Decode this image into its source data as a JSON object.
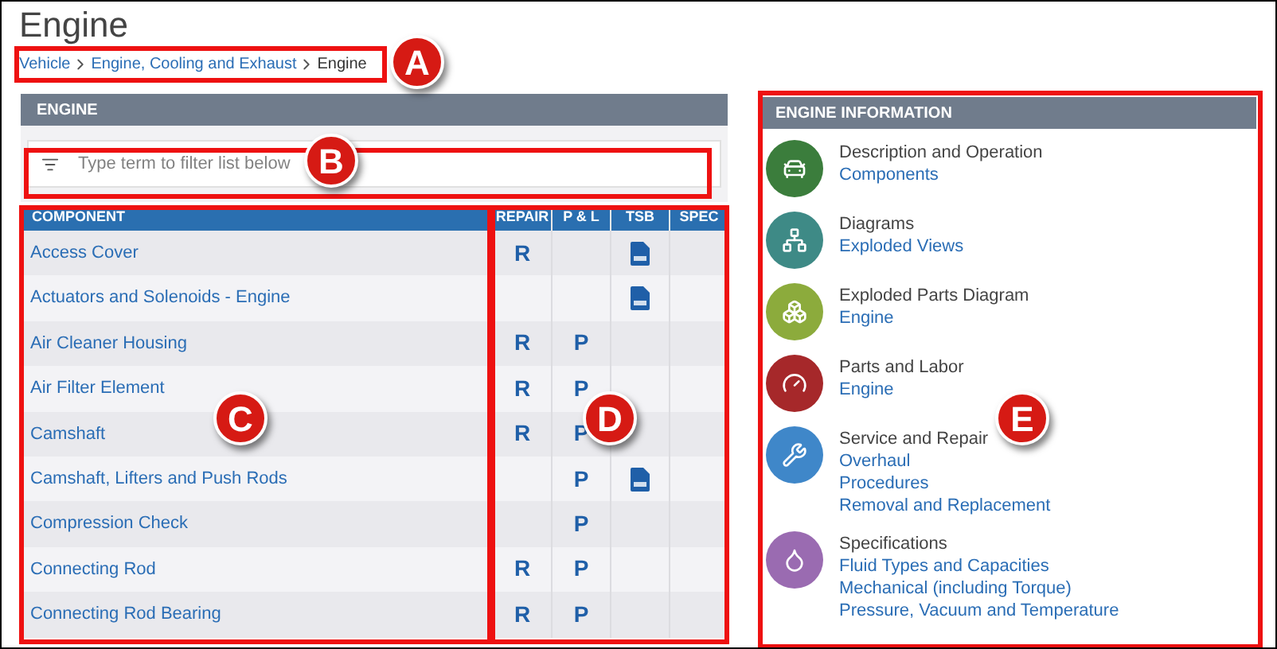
{
  "page": {
    "title": "Engine"
  },
  "breadcrumb": [
    {
      "label": "Vehicle",
      "current": false
    },
    {
      "label": "Engine, Cooling and Exhaust",
      "current": false
    },
    {
      "label": "Engine",
      "current": true
    }
  ],
  "engine_panel": {
    "title": "ENGINE",
    "filter": {
      "placeholder": "Type term to filter list below"
    },
    "table": {
      "columns": [
        "COMPONENT",
        "REPAIR",
        "P & L",
        "TSB",
        "SPEC"
      ],
      "rows": [
        {
          "component": "Access Cover",
          "repair": "R",
          "tsb": true
        },
        {
          "component": "Actuators and Solenoids - Engine",
          "tsb": true
        },
        {
          "component": "Air Cleaner Housing",
          "repair": "R",
          "p_and_l": "P",
          "tsb": false
        },
        {
          "component": "Air Filter Element",
          "repair": "R",
          "p_and_l": "P",
          "tsb": false
        },
        {
          "component": "Camshaft",
          "repair": "R",
          "p_and_l": "P",
          "tsb": false
        },
        {
          "component": "Camshaft, Lifters and Push Rods",
          "p_and_l": "P",
          "tsb": true
        },
        {
          "component": "Compression Check",
          "p_and_l": "P",
          "tsb": false
        },
        {
          "component": "Connecting Rod",
          "repair": "R",
          "p_and_l": "P",
          "tsb": false
        },
        {
          "component": "Connecting Rod Bearing",
          "repair": "R",
          "p_and_l": "P",
          "tsb": false
        }
      ]
    }
  },
  "info_panel": {
    "title": "ENGINE INFORMATION",
    "sections": [
      {
        "title": "Description and Operation",
        "color": "#3b7d3c",
        "links": [
          "Components"
        ]
      },
      {
        "title": "Diagrams",
        "color": "#3e8a86",
        "links": [
          "Exploded Views"
        ]
      },
      {
        "title": "Exploded Parts Diagram",
        "color": "#8cab3c",
        "links": [
          "Engine"
        ]
      },
      {
        "title": "Parts and Labor",
        "color": "#a6282a",
        "links": [
          "Engine"
        ]
      },
      {
        "title": "Service and Repair",
        "color": "#3f87c9",
        "links": [
          "Overhaul",
          "Procedures",
          "Removal and Replacement"
        ]
      },
      {
        "title": "Specifications",
        "color": "#9a6bb1",
        "links": [
          "Fluid Types and Capacities",
          "Mechanical (including Torque)",
          "Pressure, Vacuum and Temperature"
        ]
      }
    ]
  },
  "callouts": [
    {
      "label": "A"
    },
    {
      "label": "B"
    },
    {
      "label": "C"
    },
    {
      "label": "D"
    },
    {
      "label": "E"
    }
  ]
}
